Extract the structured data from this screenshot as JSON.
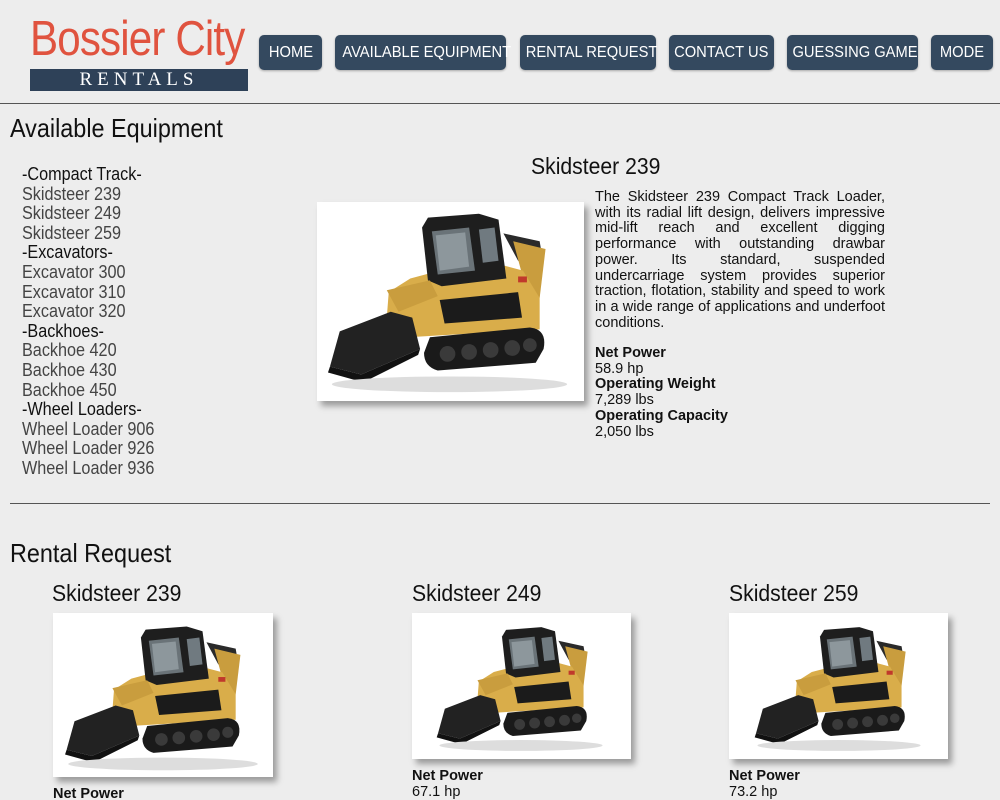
{
  "brand": {
    "name_top": "Bossier City",
    "name_bottom": "RENTALS"
  },
  "nav": {
    "home": "HOME",
    "available_equipment": "AVAILABLE EQUIPMENT",
    "rental_request": "RENTAL REQUEST",
    "contact_us": "CONTACT US",
    "guessing_game": "GUESSING GAME",
    "mode": "MODE"
  },
  "available": {
    "title": "Available Equipment",
    "list": [
      {
        "text": "-Compact Track-",
        "kind": "group"
      },
      {
        "text": "Skidsteer 239",
        "kind": "item"
      },
      {
        "text": "Skidsteer 249",
        "kind": "item"
      },
      {
        "text": "Skidsteer 259",
        "kind": "item"
      },
      {
        "text": "-Excavators-",
        "kind": "group"
      },
      {
        "text": "Excavator 300",
        "kind": "item"
      },
      {
        "text": "Excavator 310",
        "kind": "item"
      },
      {
        "text": "Excavator 320",
        "kind": "item"
      },
      {
        "text": "-Backhoes-",
        "kind": "group"
      },
      {
        "text": "Backhoe 420",
        "kind": "item"
      },
      {
        "text": "Backhoe 430",
        "kind": "item"
      },
      {
        "text": "Backhoe 450",
        "kind": "item"
      },
      {
        "text": "-Wheel Loaders-",
        "kind": "group"
      },
      {
        "text": "Wheel Loader 906",
        "kind": "item"
      },
      {
        "text": "Wheel Loader 926",
        "kind": "item"
      },
      {
        "text": "Wheel Loader 936",
        "kind": "item"
      }
    ],
    "featured": {
      "name": "Skidsteer 239",
      "description": "The Skidsteer 239 Compact Track Loader, with its radial lift design, delivers impressive mid-lift reach and excellent digging performance with outstanding drawbar power. Its standard, suspended undercarriage system provides superior traction, flotation, stability and speed to work in a wide range of applications and underfoot conditions.",
      "net_power_label": "Net Power",
      "net_power": "58.9 hp",
      "weight_label": "Operating Weight",
      "weight": "7,289 lbs",
      "capacity_label": "Operating Capacity",
      "capacity": "2,050 lbs"
    }
  },
  "rental": {
    "title": "Rental Request",
    "cards": [
      {
        "name": "Skidsteer 239",
        "net_power_label": "Net Power",
        "net_power": ""
      },
      {
        "name": "Skidsteer 249",
        "net_power_label": "Net Power",
        "net_power": "67.1 hp"
      },
      {
        "name": "Skidsteer 259",
        "net_power_label": "Net Power",
        "net_power": "73.2 hp"
      }
    ]
  },
  "colors": {
    "brand_red": "#e0533f",
    "nav_bg": "#34495f",
    "page_bg": "#ededed",
    "machine_yellow": "#d9ad4a"
  }
}
